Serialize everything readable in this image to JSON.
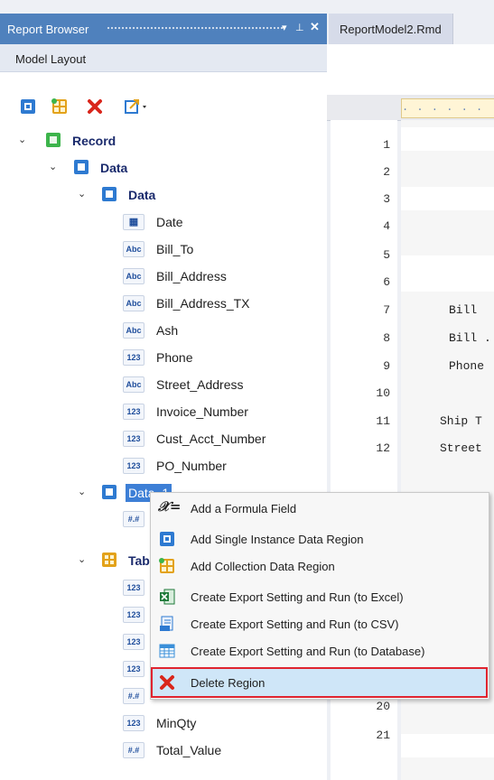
{
  "panel": {
    "title": "Report Browser",
    "pin_label": "▾ ⅌ ✕",
    "subtab": "Model Layout"
  },
  "toolbar": {
    "items": [
      {
        "name": "add-single-region-icon",
        "color": "#2e7ad1"
      },
      {
        "name": "add-collection-region-icon",
        "color": "#e3a21a"
      },
      {
        "name": "delete-icon",
        "color": "#d9261c"
      },
      {
        "name": "export-icon",
        "color": "#2e7ad1"
      }
    ]
  },
  "tree": {
    "record": "Record",
    "data1": "Data",
    "data2": "Data",
    "fields": [
      {
        "type": "date",
        "label": "Date"
      },
      {
        "type": "Abc",
        "label": "Bill_To"
      },
      {
        "type": "Abc",
        "label": "Bill_Address"
      },
      {
        "type": "Abc",
        "label": "Bill_Address_TX"
      },
      {
        "type": "Abc",
        "label": "Ash"
      },
      {
        "type": "123",
        "label": "Phone"
      },
      {
        "type": "Abc",
        "label": "Street_Address"
      },
      {
        "type": "123",
        "label": "Invoice_Number"
      },
      {
        "type": "123",
        "label": "Cust_Acct_Number"
      },
      {
        "type": "123",
        "label": "PO_Number"
      }
    ],
    "data_selected": "Data_1",
    "under_data1_type": "#.#",
    "table": "Tab",
    "table_fields": [
      {
        "type": "123",
        "label": ""
      },
      {
        "type": "123",
        "label": ""
      },
      {
        "type": "123",
        "label": ""
      },
      {
        "type": "123",
        "label": ""
      },
      {
        "type": "#.#",
        "label": ""
      },
      {
        "type": "123",
        "label": "MinQty"
      },
      {
        "type": "#.#",
        "label": "Total_Value"
      }
    ]
  },
  "editor": {
    "tab": "ReportModel2.Rmd",
    "ruler": ". . . . . . . . .",
    "lines": [
      "1",
      "2",
      "3",
      "4",
      "5",
      "6",
      "7",
      "8",
      "9",
      "10",
      "11",
      "12",
      "20",
      "21"
    ],
    "code": {
      "7": "Bill ",
      "8": "Bill .",
      "9": "Phone",
      "11": "Ship T",
      "12": "Street"
    }
  },
  "menu": {
    "items": [
      {
        "label": "Add a Formula Field",
        "icon": "formula-icon"
      },
      {
        "label": "Add Single Instance Data Region",
        "icon": "single-region-icon"
      },
      {
        "label": "Add Collection Data Region",
        "icon": "collection-region-icon"
      },
      {
        "label": "Create Export Setting and Run (to Excel)",
        "icon": "excel-icon"
      },
      {
        "label": "Create Export Setting and Run (to CSV)",
        "icon": "csv-icon"
      },
      {
        "label": "Create Export Setting and Run (to Database)",
        "icon": "database-icon"
      },
      {
        "label": "Delete Region",
        "icon": "delete-icon"
      }
    ]
  },
  "colors": {
    "title_bar": "#4f81bd",
    "record_green": "#3cb44b",
    "region_blue": "#2e7ad1",
    "collection_orange": "#e3a21a",
    "delete_red": "#d9261c",
    "highlight_border": "#e0242f"
  }
}
